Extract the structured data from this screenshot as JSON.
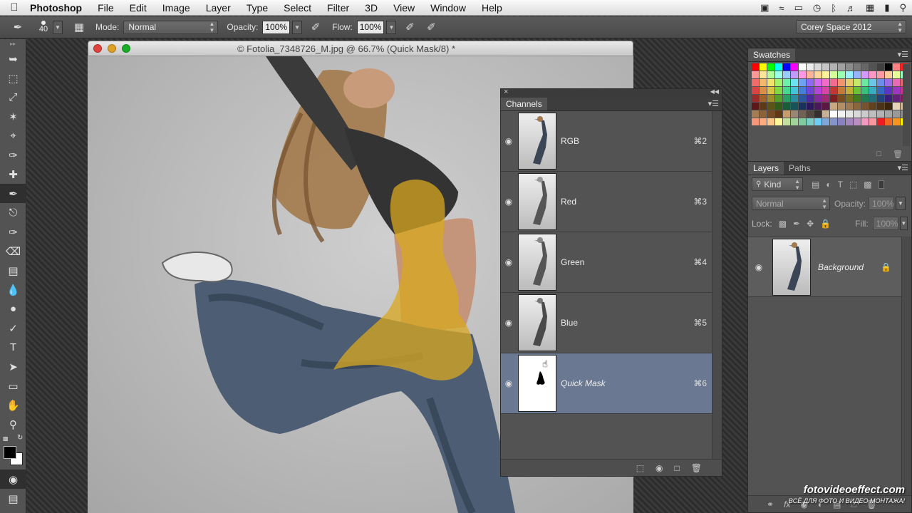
{
  "menubar": {
    "app_name": "Photoshop",
    "menus": [
      "File",
      "Edit",
      "Image",
      "Layer",
      "Type",
      "Select",
      "Filter",
      "3D",
      "View",
      "Window",
      "Help"
    ]
  },
  "options": {
    "brush_size": "40",
    "mode_label": "Mode:",
    "mode_value": "Normal",
    "opacity_label": "Opacity:",
    "opacity_value": "100%",
    "flow_label": "Flow:",
    "flow_value": "100%",
    "workspace": "Corey Space 2012"
  },
  "document": {
    "title": "© Fotolia_7348726_M.jpg @ 66.7% (Quick Mask/8) *"
  },
  "channels": {
    "tab": "Channels",
    "items": [
      {
        "name": "RGB",
        "shortcut": "⌘2",
        "selected": false
      },
      {
        "name": "Red",
        "shortcut": "⌘3",
        "selected": false
      },
      {
        "name": "Green",
        "shortcut": "⌘4",
        "selected": false
      },
      {
        "name": "Blue",
        "shortcut": "⌘5",
        "selected": false
      },
      {
        "name": "Quick Mask",
        "shortcut": "⌘6",
        "selected": true
      }
    ]
  },
  "swatches": {
    "tab": "Swatches",
    "colors": [
      "#ff0000",
      "#ffff00",
      "#00ff00",
      "#00ffff",
      "#0000ff",
      "#ff00ff",
      "#ffffff",
      "#ececec",
      "#d9d9d9",
      "#c6c6c6",
      "#b3b3b3",
      "#a0a0a0",
      "#8c8c8c",
      "#797979",
      "#666666",
      "#535353",
      "#404040",
      "#000000",
      "#ff8080",
      "#ff2020",
      "#ff9999",
      "#ffe699",
      "#b3ff99",
      "#99ffe6",
      "#99ccff",
      "#c299ff",
      "#ff99e6",
      "#ffb399",
      "#ffd699",
      "#fff099",
      "#d6ff99",
      "#99ffb3",
      "#99f0ff",
      "#99b3ff",
      "#d699ff",
      "#ff99c2",
      "#ff99a3",
      "#ffcc99",
      "#e6ff99",
      "#99ffcc",
      "#f26b6b",
      "#f2b86b",
      "#f2e36b",
      "#a3f26b",
      "#6bf2a8",
      "#6be3f2",
      "#6ba3f2",
      "#8e6bf2",
      "#d16bf2",
      "#f26bc8",
      "#f26b8e",
      "#f2946b",
      "#e8c86b",
      "#c8e86b",
      "#6be8a0",
      "#6bc8e8",
      "#6b8ee8",
      "#a06be8",
      "#e86bb4",
      "#e86b6b",
      "#d94545",
      "#d98f45",
      "#d9c445",
      "#7fd945",
      "#45d990",
      "#45c4d9",
      "#457fd9",
      "#7045d9",
      "#b545d9",
      "#d945a6",
      "#c23636",
      "#c27a36",
      "#c2ad36",
      "#6bc236",
      "#36c27a",
      "#36adc2",
      "#366bc2",
      "#5c36c2",
      "#9e36c2",
      "#c2368f",
      "#9e2b2b",
      "#9e642b",
      "#9e8e2b",
      "#579e2b",
      "#2b9e64",
      "#2b8e9e",
      "#2b579e",
      "#4b2b9e",
      "#812b9e",
      "#9e2b74",
      "#7a2020",
      "#7a4d20",
      "#7a6e20",
      "#437a20",
      "#207a4d",
      "#206e7a",
      "#20437a",
      "#3a207a",
      "#64207a",
      "#7a2059",
      "#5c1818",
      "#5c3a18",
      "#5c5318",
      "#325c18",
      "#185c3a",
      "#18535c",
      "#18325c",
      "#2c185c",
      "#4b185c",
      "#5c1843",
      "#c8a882",
      "#b38f66",
      "#9e7a52",
      "#8a663f",
      "#75532e",
      "#614220",
      "#4d3315",
      "#3a250c",
      "#e6d2b8",
      "#d4bb9c",
      "#a67c52",
      "#8c6239",
      "#754c24",
      "#603913",
      "#c69c6d",
      "#998675",
      "#736357",
      "#534741",
      "#362f2d",
      "#c7b299",
      "#ffffff",
      "#f2f2f2",
      "#e6e6e6",
      "#d9d9d9",
      "#cccccc",
      "#bfbfbf",
      "#b3b3b3",
      "#a6a6a6",
      "#999999",
      "#8c8c8c",
      "#f7977a",
      "#f9ad81",
      "#fdc68a",
      "#fff79a",
      "#c4df9b",
      "#a2d39c",
      "#82ca9d",
      "#7bcdc8",
      "#6ecff6",
      "#7ea7d8",
      "#8493ca",
      "#8882be",
      "#a187be",
      "#bc8dbf",
      "#f49ac2",
      "#f6989d",
      "#ed1c24",
      "#f26522",
      "#f7941d",
      "#fff200"
    ]
  },
  "layers": {
    "tabs": [
      "Layers",
      "Paths"
    ],
    "kind": "Kind",
    "blend": "Normal",
    "opacity_label": "Opacity:",
    "opacity_value": "100%",
    "lock_label": "Lock:",
    "fill_label": "Fill:",
    "fill_value": "100%",
    "layer_name": "Background"
  },
  "watermark": {
    "site": "fotovideoeffect.com",
    "tagline": "ВСЁ ДЛЯ ФОТО И ВИДЕО МОНТАЖА!"
  }
}
